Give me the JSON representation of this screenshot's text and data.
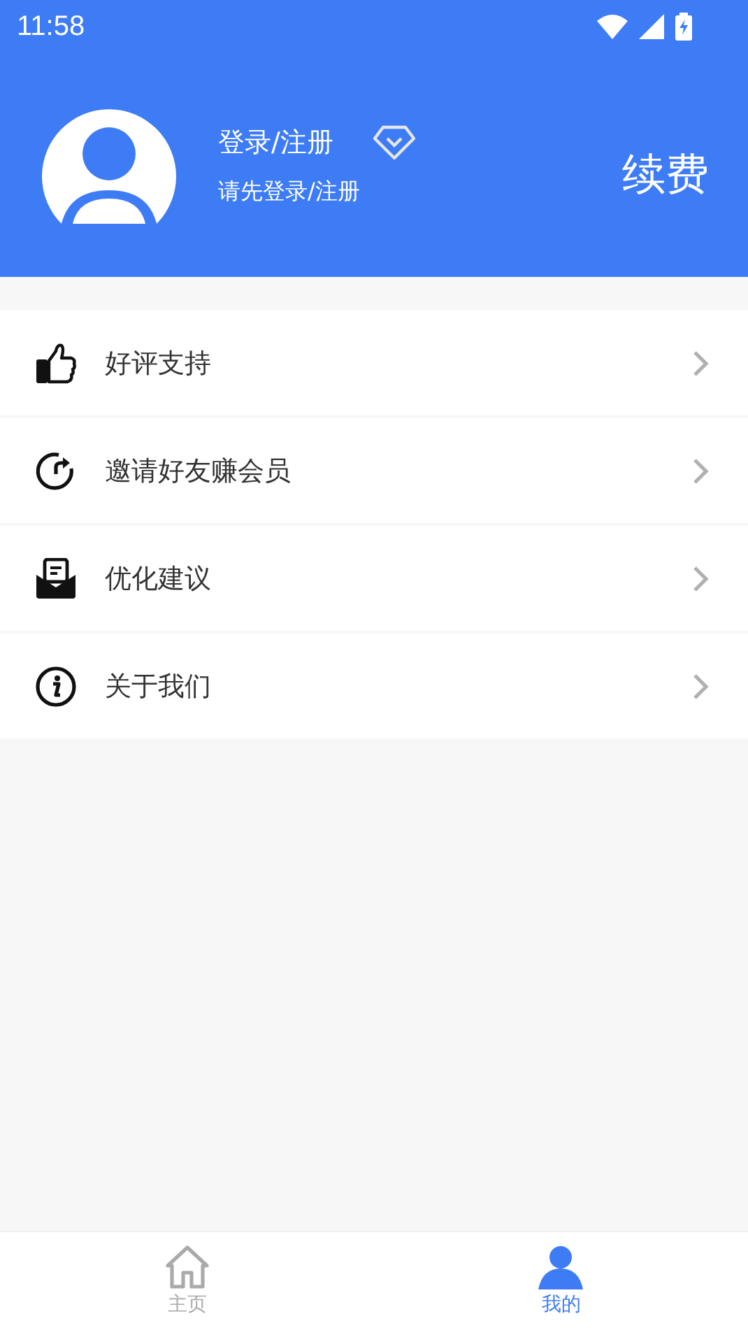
{
  "status_bar": {
    "time": "11:58"
  },
  "profile": {
    "name": "登录/注册",
    "hint": "请先登录/注册",
    "renew": "续费"
  },
  "menu": [
    {
      "kind": "thumb",
      "label": "好评支持"
    },
    {
      "kind": "share",
      "label": "邀请好友赚会员"
    },
    {
      "kind": "mail",
      "label": "优化建议"
    },
    {
      "kind": "info",
      "label": "关于我们"
    }
  ],
  "tabs": [
    {
      "kind": "home",
      "label": "主页",
      "selected": false
    },
    {
      "kind": "profile",
      "label": "我的",
      "selected": true
    }
  ]
}
